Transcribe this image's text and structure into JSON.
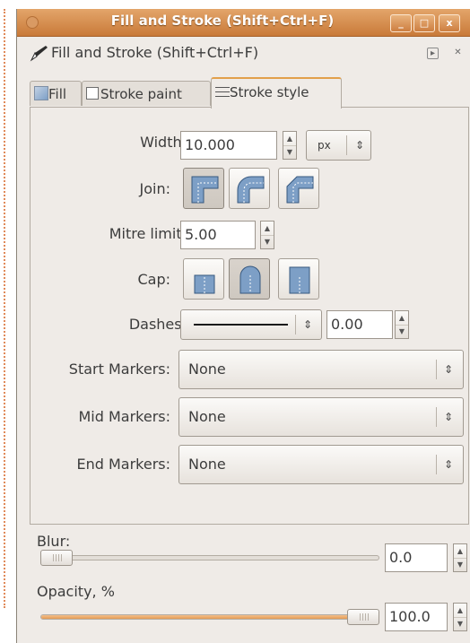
{
  "window": {
    "title": "Fill and Stroke (Shift+Ctrl+F)",
    "buttons": {
      "minimize": "_",
      "maximize": "□",
      "close": "x"
    }
  },
  "panel": {
    "title": "Fill and Stroke (Shift+Ctrl+F)"
  },
  "tabs": [
    {
      "label": "Fill",
      "icon": "fill-swatch-icon",
      "active": false
    },
    {
      "label": "Stroke paint",
      "icon": "stroke-paint-swatch-icon",
      "active": false
    },
    {
      "label": "Stroke style",
      "icon": "stroke-style-lines-icon",
      "active": true
    }
  ],
  "stroke_style": {
    "width_label": "Width:",
    "width_value": "10.000",
    "unit": "px",
    "join_label": "Join:",
    "join_selected": "miter",
    "mitre_label": "Mitre limit:",
    "mitre_value": "5.00",
    "cap_label": "Cap:",
    "cap_selected": "round",
    "dashes_label": "Dashes:",
    "dash_offset": "0.00",
    "start_markers_label": "Start Markers:",
    "start_markers_value": "None",
    "mid_markers_label": "Mid Markers:",
    "mid_markers_value": "None",
    "end_markers_label": "End Markers:",
    "end_markers_value": "None"
  },
  "blur": {
    "label": "Blur:",
    "value": "0.0",
    "level_percent": 0
  },
  "opacity": {
    "label": "Opacity, %",
    "value": "100.0",
    "level_percent": 100
  },
  "colors": {
    "accent": "#e2a04b",
    "titlebar": "#d88a48",
    "icon_fill": "#7d9fc6"
  }
}
